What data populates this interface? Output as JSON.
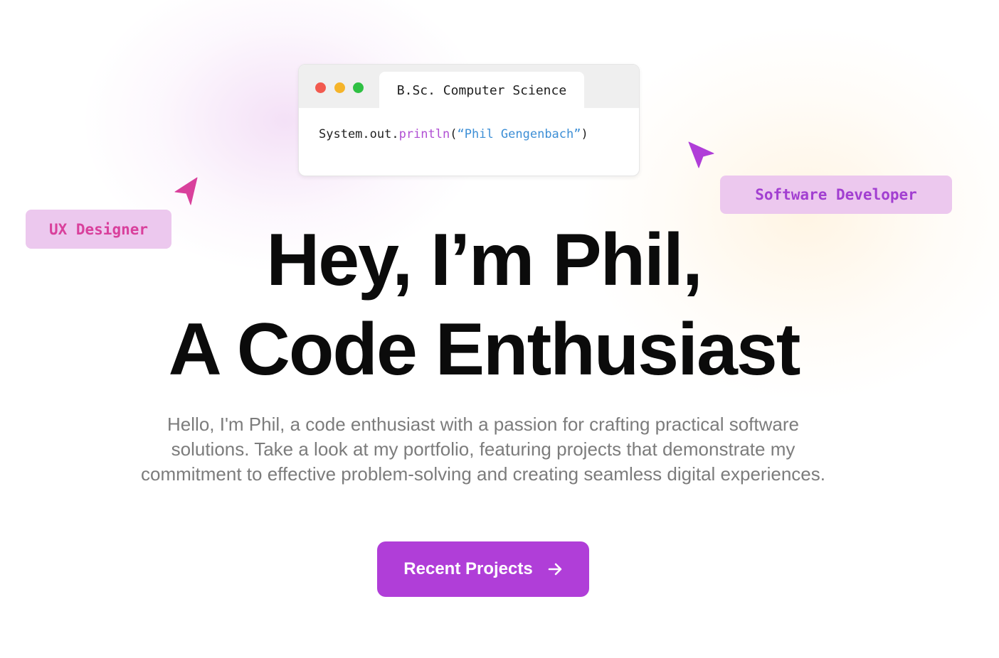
{
  "code_window": {
    "tab_label": "B.Sc. Computer Science",
    "code": {
      "prefix": "System.out.",
      "function": "println",
      "open": "(",
      "string": "“Phil Gengenbach”",
      "close": ")"
    },
    "window_dots": [
      "red",
      "yellow",
      "green"
    ]
  },
  "badges": {
    "ux": "UX Designer",
    "developer": "Software Developer"
  },
  "hero": {
    "title_line1": "Hey, I’m Phil,",
    "title_line2": "A Code Enthusiast",
    "description": "Hello, I'm Phil, a code enthusiast with a passion for crafting practical software solutions. Take a look at my portfolio, featuring projects that demonstrate my commitment to effective problem-solving and creating seamless digital experiences.",
    "cta_label": "Recent Projects"
  },
  "icons": {
    "cta": "arrow-right-icon",
    "cursors": [
      "cursor-arrow-icon",
      "cursor-arrow-icon"
    ]
  },
  "colors": {
    "accent_purple": "#b03ed8",
    "badge_bg": "#ecc8ee",
    "ux_text": "#d9409c",
    "dev_text": "#a23fd1",
    "code_function": "#b04fd3",
    "code_string": "#3d8fd6",
    "dot_red": "#f25a4f",
    "dot_yellow": "#f5b42a",
    "dot_green": "#2fc043"
  }
}
